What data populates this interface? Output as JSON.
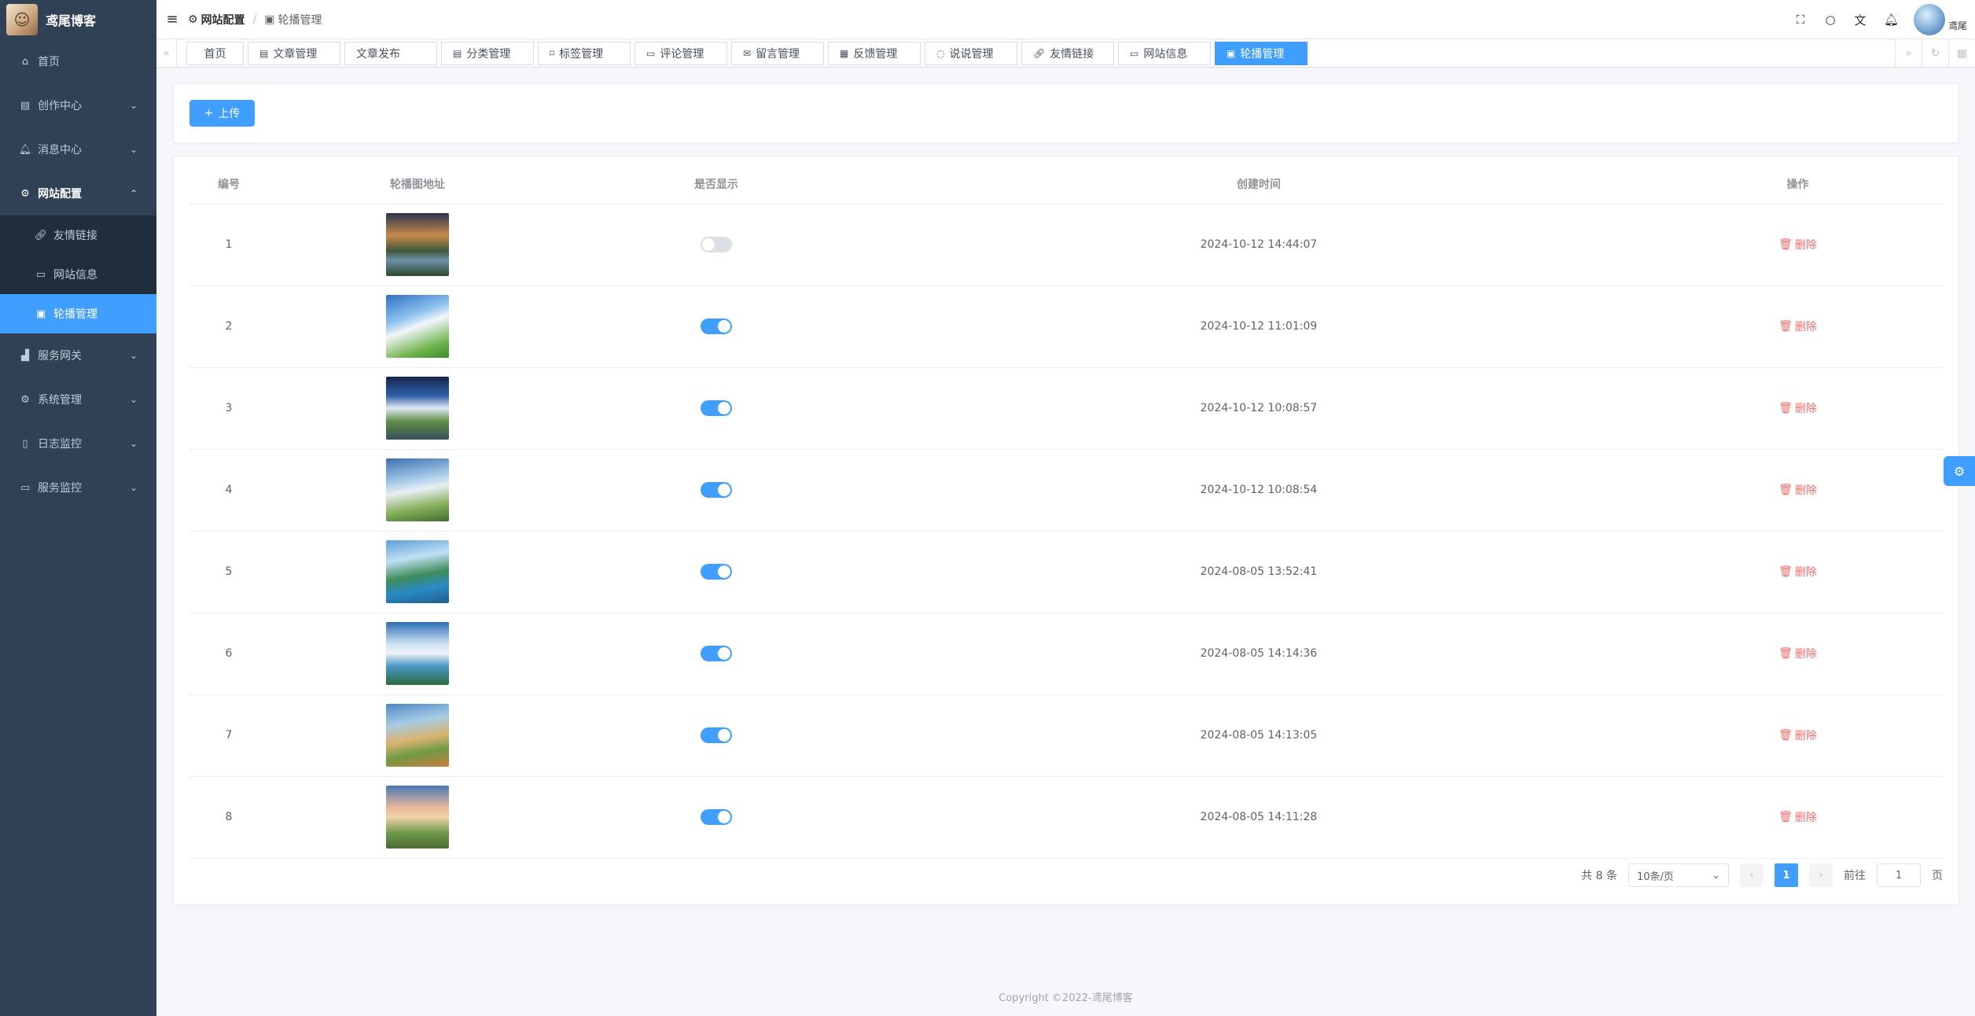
{
  "app": {
    "title": "鸢尾博客",
    "logo_icon": "avatar-logo",
    "brand_color": "#409eff"
  },
  "sidebar": {
    "items": [
      {
        "label": "首页",
        "icon": "home-icon"
      },
      {
        "label": "创作中心",
        "icon": "document-icon"
      },
      {
        "label": "消息中心",
        "icon": "bell-icon"
      },
      {
        "label": "网站配置",
        "icon": "gear-icon",
        "open": true,
        "children": [
          {
            "label": "友情链接",
            "icon": "link-icon"
          },
          {
            "label": "网站信息",
            "icon": "monitor-icon"
          },
          {
            "label": "轮播管理",
            "icon": "carousel-icon",
            "active": true
          }
        ]
      },
      {
        "label": "服务网关",
        "icon": "chart-icon"
      },
      {
        "label": "系统管理",
        "icon": "gear-icon"
      },
      {
        "label": "日志监控",
        "icon": "file-icon"
      },
      {
        "label": "服务监控",
        "icon": "monitor-icon"
      }
    ]
  },
  "navbar": {
    "breadcrumb": [
      "网站配置",
      "轮播管理"
    ],
    "user_name": "鸢尾"
  },
  "tags": [
    {
      "label": "首页"
    },
    {
      "label": "文章管理"
    },
    {
      "label": "文章发布"
    },
    {
      "label": "分类管理"
    },
    {
      "label": "标签管理"
    },
    {
      "label": "评论管理"
    },
    {
      "label": "留言管理"
    },
    {
      "label": "反馈管理"
    },
    {
      "label": "说说管理"
    },
    {
      "label": "友情链接"
    },
    {
      "label": "网站信息"
    },
    {
      "label": "轮播管理",
      "active": true
    }
  ],
  "toolbar": {
    "upload_label": "上传"
  },
  "table": {
    "headers": [
      "编号",
      "轮播图地址",
      "是否显示",
      "创建时间",
      "操作"
    ],
    "delete_label": "删除",
    "rows": [
      {
        "id": "1",
        "show": false,
        "created": "2024-10-12 14:44:07",
        "image": "river-landscape"
      },
      {
        "id": "2",
        "show": true,
        "created": "2024-10-12 11:01:09",
        "image": "clouds-meadow"
      },
      {
        "id": "3",
        "show": true,
        "created": "2024-10-12 10:08:57",
        "image": "night-road-clouds"
      },
      {
        "id": "4",
        "show": true,
        "created": "2024-10-12 10:08:54",
        "image": "sky-flower-field"
      },
      {
        "id": "5",
        "show": true,
        "created": "2024-08-05 13:52:41",
        "image": "coastal-cliff"
      },
      {
        "id": "6",
        "show": true,
        "created": "2024-08-05 14:14:36",
        "image": "seaside-rocks"
      },
      {
        "id": "7",
        "show": true,
        "created": "2024-08-05 14:13:05",
        "image": "hillside-house"
      },
      {
        "id": "8",
        "show": true,
        "created": "2024-08-05 14:11:28",
        "image": "tree-sunset"
      }
    ]
  },
  "pagination": {
    "total_text": "共 8 条",
    "page_size": "10条/页",
    "current_page": "1",
    "goto_prefix": "前往",
    "goto_value": "1",
    "goto_suffix": "页"
  },
  "footer": {
    "copyright": "Copyright ©2022-鸢尾博客"
  }
}
